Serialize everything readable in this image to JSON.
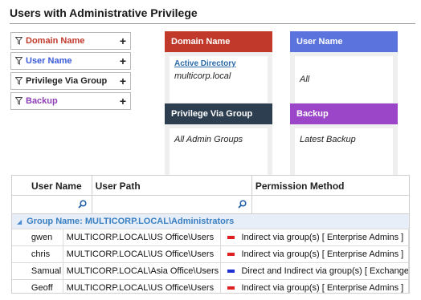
{
  "page": {
    "title": "Users with Administrative Privilege"
  },
  "filters": [
    {
      "label": "Domain Name",
      "color": "#c0392b"
    },
    {
      "label": "User Name",
      "color": "#3a5bd9"
    },
    {
      "label": "Privilege Via Group",
      "color": "#222222"
    },
    {
      "label": "Backup",
      "color": "#8e3fb5"
    }
  ],
  "cards": {
    "domain": {
      "title": "Domain Name",
      "color": "#c0392b",
      "link": "Active Directory",
      "value": "multicorp.local"
    },
    "user": {
      "title": "User Name",
      "color": "#5a73dd",
      "value": "All"
    },
    "privilege": {
      "title": "Privilege Via Group",
      "color": "#2c3e50",
      "value": "All Admin Groups"
    },
    "backup": {
      "title": "Backup",
      "color": "#9b45c9",
      "value": "Latest Backup"
    }
  },
  "grid": {
    "columns": [
      "User Name",
      "User Path",
      "Permission Method"
    ],
    "group_label": "Group Name: MULTICORP.LOCAL\\Administrators",
    "rows": [
      {
        "user": "gwen",
        "path": "MULTICORP.LOCAL\\US Office\\Users",
        "perm": "Indirect via group(s) [ Enterprise Admins  ]",
        "mark": "#e02020"
      },
      {
        "user": "chris",
        "path": "MULTICORP.LOCAL\\US Office\\Users",
        "perm": "Indirect via group(s) [ Enterprise Admins  ]",
        "mark": "#e02020"
      },
      {
        "user": "Samual",
        "path": "MULTICORP.LOCAL\\Asia Office\\Users",
        "perm": "Direct and Indirect via group(s) [ Exchange",
        "mark": "#2030d0"
      },
      {
        "user": "Geoff",
        "path": "MULTICORP.LOCAL\\US Office\\Users",
        "perm": "Indirect via group(s) [ Enterprise Admins  ]",
        "mark": "#e02020"
      }
    ]
  }
}
